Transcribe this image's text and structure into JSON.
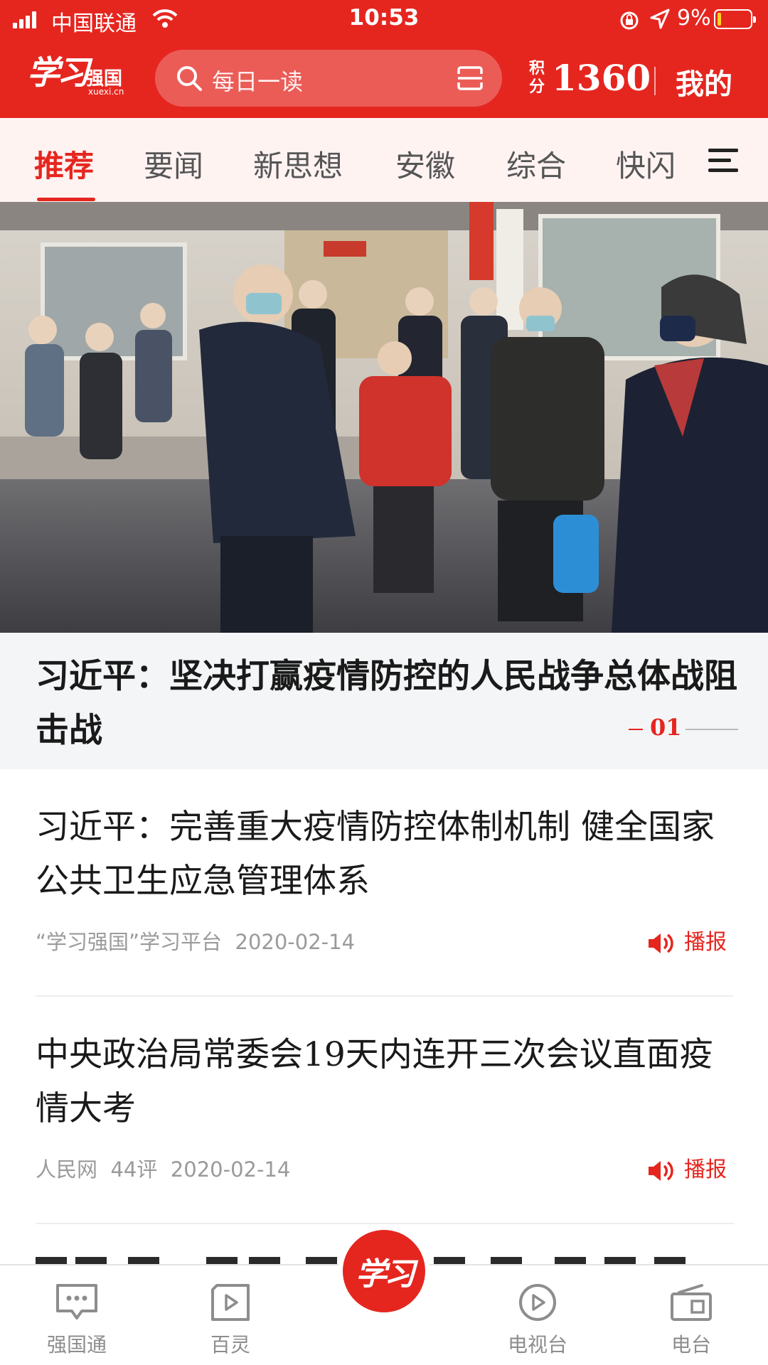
{
  "status_bar": {
    "carrier": "中国联通",
    "time": "10:53",
    "battery": "9%"
  },
  "header": {
    "logo_script": "学习",
    "logo_brand": "强国",
    "logo_domain": "xuexi.cn",
    "search_placeholder": "每日一读",
    "points_label": "积分",
    "points": "1360",
    "mine": "我的"
  },
  "tabs": [
    "推荐",
    "要闻",
    "新思想",
    "安徽",
    "综合",
    "快闪"
  ],
  "headline": {
    "title": "习近平：坚决打赢疫情防控的人民战争总体战阻击战",
    "index": "01"
  },
  "news": [
    {
      "title": "习近平：完善重大疫情防控体制机制  健全国家公共卫生应急管理体系",
      "source": "“学习强国”学习平台",
      "comments": "",
      "date": "2020-02-14",
      "action": "播报"
    },
    {
      "title": "中央政治局常委会19天内连开三次会议直面疫情大考",
      "source": "人民网",
      "comments": "44评",
      "date": "2020-02-14",
      "action": "播报"
    }
  ],
  "bottom_nav": [
    "强国通",
    "百灵",
    "学习",
    "电视台",
    "电台"
  ],
  "colors": {
    "brand_red": "#e5261f",
    "tab_bg": "#fff3f2"
  }
}
